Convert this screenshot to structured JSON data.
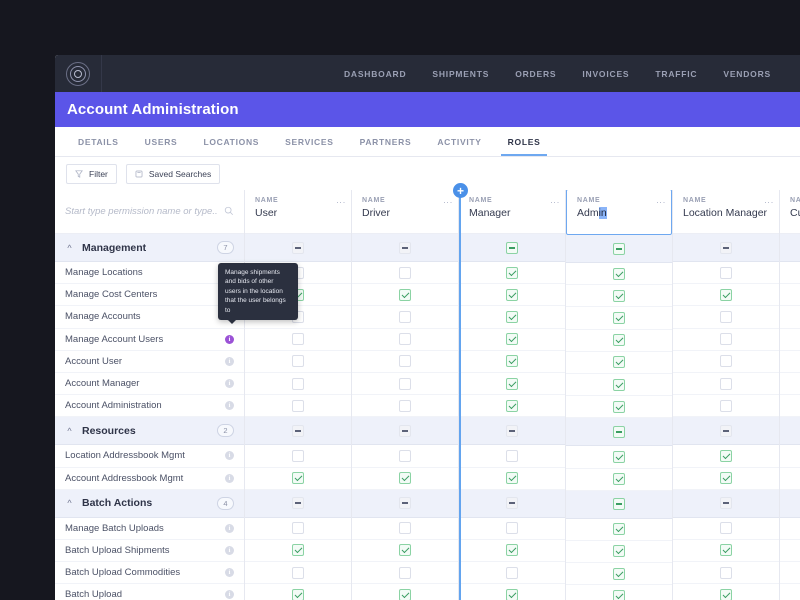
{
  "topnav": {
    "logo_name": "concentric-circles-logo",
    "items": [
      "DASHBOARD",
      "SHIPMENTS",
      "ORDERS",
      "INVOICES",
      "TRAFFIC",
      "VENDORS"
    ]
  },
  "header": {
    "title": "Account Administration"
  },
  "tabs": [
    {
      "label": "DETAILS",
      "active": false
    },
    {
      "label": "USERS",
      "active": false
    },
    {
      "label": "LOCATIONS",
      "active": false
    },
    {
      "label": "SERVICES",
      "active": false
    },
    {
      "label": "PARTNERS",
      "active": false
    },
    {
      "label": "ACTIVITY",
      "active": false
    },
    {
      "label": "ROLES",
      "active": true
    }
  ],
  "toolbar": {
    "filter_label": "Filter",
    "saved_searches_label": "Saved Searches"
  },
  "search": {
    "placeholder": "Start type permission name or type..",
    "value": ""
  },
  "columns": [
    {
      "header_label": "NAME",
      "value": "User",
      "editing": false
    },
    {
      "header_label": "NAME",
      "value": "Driver",
      "editing": false
    },
    {
      "header_label": "NAME",
      "value": "Manager",
      "editing": false
    },
    {
      "header_label": "NAME",
      "value": "Admin",
      "editing": true,
      "selected_suffix": "in"
    },
    {
      "header_label": "NAME",
      "value": "Location Manager",
      "editing": false
    },
    {
      "header_label": "NA",
      "value": "Cu",
      "editing": false
    }
  ],
  "insert_column": {
    "icon": "plus-icon",
    "label": "+"
  },
  "tooltip": {
    "text": "Manage shipments and bids of other users in the location that the user belongs to"
  },
  "groups": [
    {
      "name": "Management",
      "count": "7",
      "states": [
        "dash",
        "dash",
        "dash-green",
        "dash-green",
        "dash",
        "dash"
      ],
      "rows": [
        {
          "label": "Manage Locations",
          "info": "i",
          "info_active": false,
          "states": [
            "off",
            "off",
            "on",
            "on",
            "off",
            "off"
          ]
        },
        {
          "label": "Manage Cost Centers",
          "info": "i",
          "info_active": false,
          "states": [
            "on",
            "on",
            "on",
            "on",
            "on",
            "off"
          ]
        },
        {
          "label": "Manage Accounts",
          "info": "i",
          "info_active": false,
          "states": [
            "off",
            "off",
            "on",
            "on",
            "off",
            "off"
          ]
        },
        {
          "label": "Manage Account Users",
          "info": "i",
          "info_active": true,
          "states": [
            "off",
            "off",
            "on",
            "on",
            "off",
            "off"
          ]
        },
        {
          "label": "Account User",
          "info": "i",
          "info_active": false,
          "states": [
            "off",
            "off",
            "on",
            "on",
            "off",
            "off"
          ]
        },
        {
          "label": "Account Manager",
          "info": "i",
          "info_active": false,
          "states": [
            "off",
            "off",
            "on",
            "on",
            "off",
            "off"
          ]
        },
        {
          "label": "Account Administration",
          "info": "i",
          "info_active": false,
          "states": [
            "off",
            "off",
            "on",
            "on",
            "off",
            "off"
          ]
        }
      ]
    },
    {
      "name": "Resources",
      "count": "2",
      "states": [
        "dash",
        "dash",
        "dash",
        "dash-green",
        "dash",
        "dash"
      ],
      "rows": [
        {
          "label": "Location Addressbook Mgmt",
          "info": "i",
          "info_active": false,
          "states": [
            "off",
            "off",
            "off",
            "on",
            "on",
            "off"
          ]
        },
        {
          "label": "Account Addressbook Mgmt",
          "info": "i",
          "info_active": false,
          "states": [
            "on",
            "on",
            "on",
            "on",
            "on",
            "off"
          ]
        }
      ]
    },
    {
      "name": "Batch Actions",
      "count": "4",
      "states": [
        "dash",
        "dash",
        "dash",
        "dash-green",
        "dash",
        "dash"
      ],
      "rows": [
        {
          "label": "Manage Batch Uploads",
          "info": "i",
          "info_active": false,
          "states": [
            "off",
            "off",
            "off",
            "on",
            "off",
            "off"
          ]
        },
        {
          "label": "Batch Upload Shipments",
          "info": "i",
          "info_active": false,
          "states": [
            "on",
            "on",
            "on",
            "on",
            "on",
            "off"
          ]
        },
        {
          "label": "Batch Upload Commodities",
          "info": "i",
          "info_active": false,
          "states": [
            "off",
            "off",
            "off",
            "on",
            "off",
            "off"
          ]
        },
        {
          "label": "Batch Upload",
          "info": "i",
          "info_active": false,
          "states": [
            "on",
            "on",
            "on",
            "on",
            "on",
            "off"
          ]
        }
      ]
    }
  ],
  "colors": {
    "page_background": "#16171f",
    "topnav": "#272b38",
    "titlebar_purple": "#5b55e8",
    "tab_active_underline": "#6ea8f0",
    "group_row": "#eef1fa",
    "checkbox_on": "#8bd3a4",
    "check_mark": "#3a9d62",
    "insert_blue": "#4a90e8",
    "info_active": "#9b52d6",
    "tooltip_bg": "#2b303f"
  }
}
